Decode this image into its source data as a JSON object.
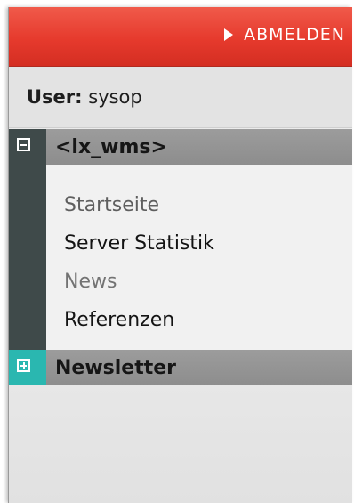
{
  "topbar": {
    "logout_label": "ABMELDEN",
    "accent_color": "#e63a2d"
  },
  "user": {
    "label": "User:",
    "name": "sysop"
  },
  "sections": [
    {
      "title": "<lx_wms>",
      "state": "expanded",
      "toggle_icon": "minus-box-icon",
      "items": [
        "Startseite",
        "Server Statistik",
        "News",
        "Referenzen"
      ]
    },
    {
      "title": "Newsletter",
      "state": "collapsed",
      "toggle_icon": "plus-box-icon",
      "accent_color": "#2ab7b0"
    }
  ]
}
